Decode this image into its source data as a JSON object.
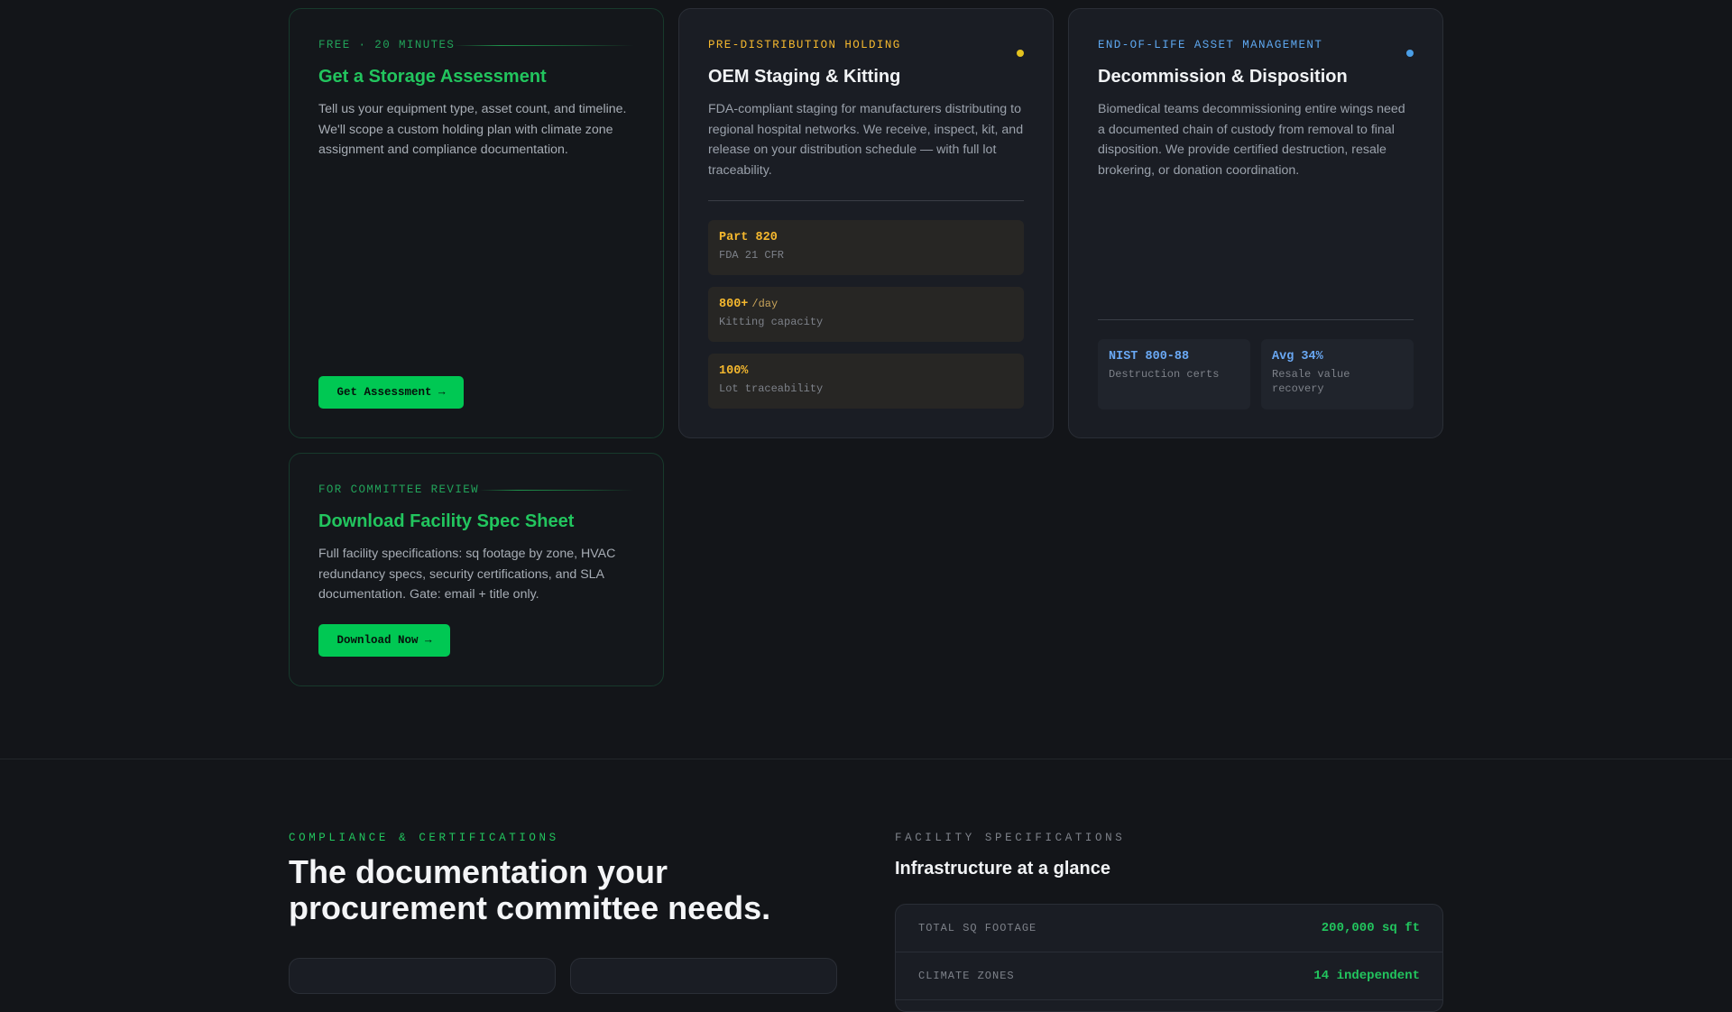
{
  "cards": {
    "assessment": {
      "eyebrow": "FREE · 20 MINUTES",
      "title": "Get a Storage Assessment",
      "description": "Tell us your equipment type, asset count, and timeline. We'll scope a custom holding plan with climate zone assignment and compliance documentation.",
      "button_label": "Get Assessment →"
    },
    "oem": {
      "eyebrow": "PRE-DISTRIBUTION HOLDING",
      "title": "OEM Staging & Kitting",
      "description": "FDA-compliant staging for manufacturers distributing to regional hospital networks. We receive, inspect, kit, and release on your distribution schedule — with full lot traceability.",
      "accent_color": "#f5b82e",
      "stats": [
        {
          "value": "Part 820",
          "unit": "",
          "label": "FDA 21 CFR"
        },
        {
          "value": "800+",
          "unit": "/day",
          "label": "Kitting capacity"
        },
        {
          "value": "100%",
          "unit": "",
          "label": "Lot traceability"
        }
      ]
    },
    "decommission": {
      "eyebrow": "END-OF-LIFE ASSET MANAGEMENT",
      "title": "Decommission & Disposition",
      "description": "Biomedical teams decommissioning entire wings need a documented chain of custody from removal to final disposition. We provide certified destruction, resale brokering, or donation coordination.",
      "accent_color": "#5ea8f0",
      "stats": [
        {
          "value": "NIST 800-88",
          "label": "Destruction certs"
        },
        {
          "value": "Avg 34%",
          "label": "Resale value recovery"
        }
      ]
    },
    "spec_sheet": {
      "eyebrow": "FOR COMMITTEE REVIEW",
      "title": "Download Facility Spec Sheet",
      "description": "Full facility specifications: sq footage by zone, HVAC redundancy specs, security certifications, and SLA documentation. Gate: email + title only.",
      "button_label": "Download Now →"
    }
  },
  "compliance": {
    "eyebrow": "COMPLIANCE & CERTIFICATIONS",
    "title": "The documentation your procurement committee needs."
  },
  "facility": {
    "eyebrow": "FACILITY SPECIFICATIONS",
    "title": "Infrastructure at a glance",
    "rows": [
      {
        "key": "TOTAL SQ FOOTAGE",
        "value": "200,000 sq ft"
      },
      {
        "key": "CLIMATE ZONES",
        "value": "14 independent"
      }
    ]
  },
  "colors": {
    "brand_green": "#22c55e",
    "button_green": "#00c853",
    "amber": "#f5b82e",
    "blue": "#5ea8f0",
    "background": "#131519"
  }
}
